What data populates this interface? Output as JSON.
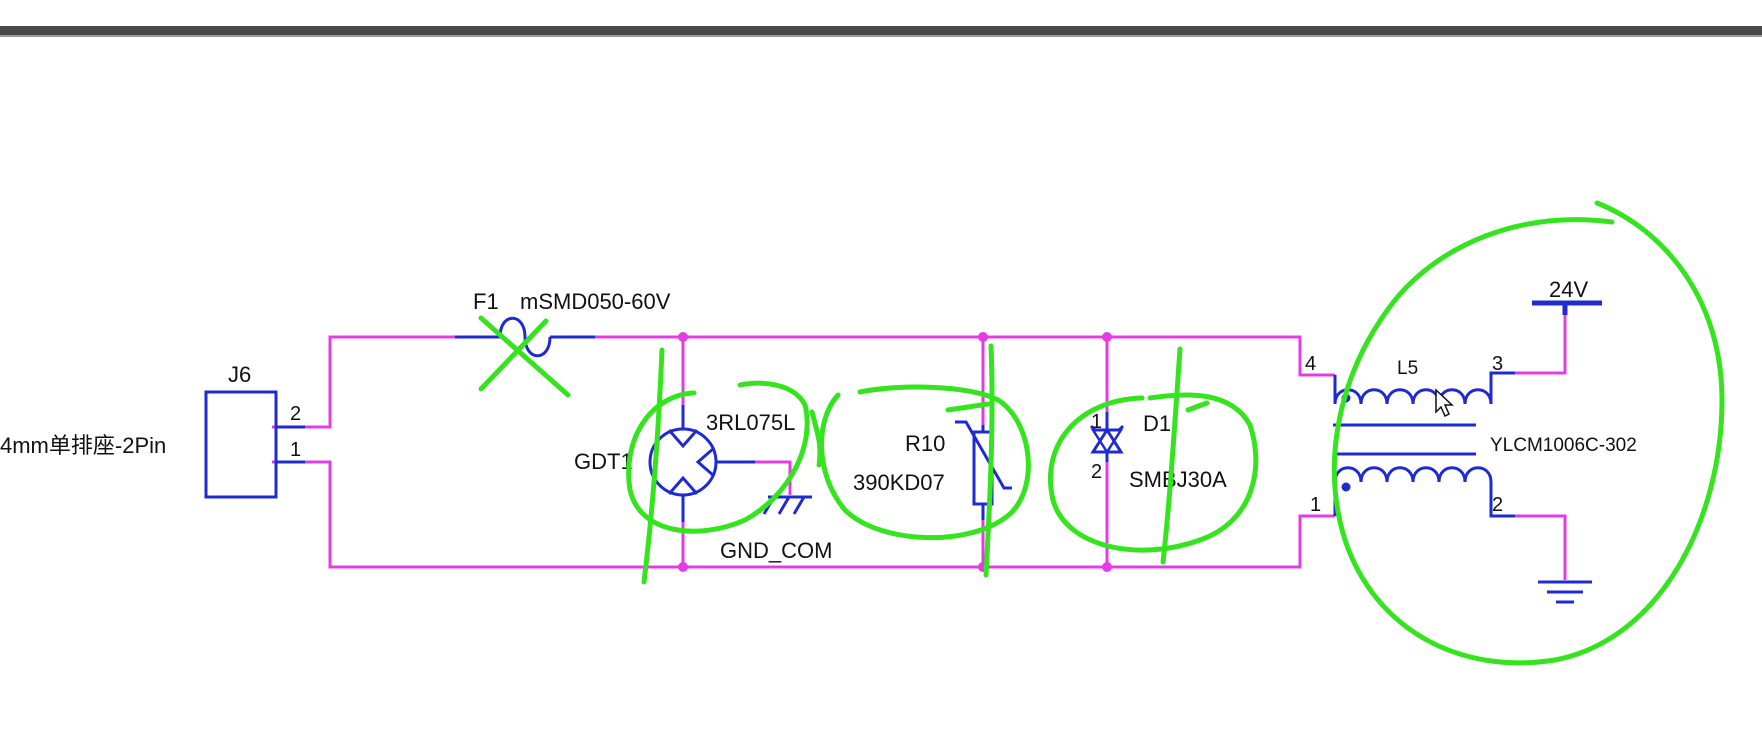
{
  "colors": {
    "wire": "#e43ce4",
    "component": "#1f2bd0",
    "markup": "#35e31f",
    "text": "#111111",
    "frame_bar": "#4a4a4a",
    "background": "#ffffff"
  },
  "connector": {
    "ref": "J6",
    "value": "4mm单排座-2Pin",
    "pin_top": "2",
    "pin_bottom": "1"
  },
  "fuse": {
    "ref": "F1",
    "value": "mSMD050-60V"
  },
  "gdt": {
    "ref": "GDT1",
    "value": "3RL075L"
  },
  "ground_label": "GND_COM",
  "varistor": {
    "ref": "R10",
    "value": "390KD07"
  },
  "tvs": {
    "ref": "D1",
    "value": "SMBJ30A",
    "pin_top": "1",
    "pin_bottom": "2"
  },
  "choke": {
    "ref": "L5",
    "value": "YLCM1006C-302",
    "pin_1": "1",
    "pin_2": "2",
    "pin_3": "3",
    "pin_4": "4"
  },
  "power_label": "24V",
  "icons": [
    "ground-symbol-icon",
    "mouse-cursor-icon"
  ]
}
